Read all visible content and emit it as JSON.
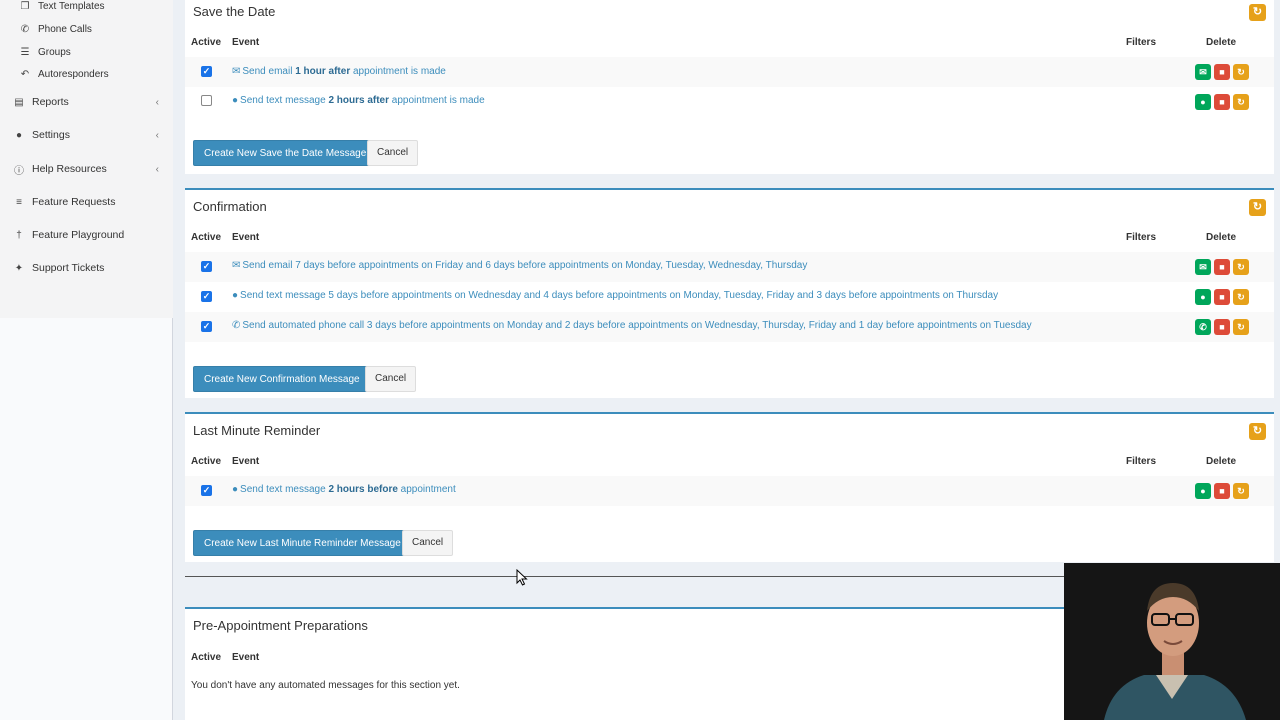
{
  "sidebar": {
    "sub_items": [
      {
        "label": "Text Templates",
        "icon": "copy-icon"
      },
      {
        "label": "Phone Calls",
        "icon": "phone-icon"
      },
      {
        "label": "Groups",
        "icon": "list-icon"
      },
      {
        "label": "Autoresponders",
        "icon": "reply-icon"
      }
    ],
    "items": [
      {
        "label": "Reports",
        "icon": "book-icon",
        "has_chevron": true
      },
      {
        "label": "Settings",
        "icon": "user-icon",
        "has_chevron": true
      },
      {
        "label": "Help Resources",
        "icon": "info-icon",
        "has_chevron": true
      },
      {
        "label": "Feature Requests",
        "icon": "list-ordered-icon",
        "has_chevron": false
      },
      {
        "label": "Feature Playground",
        "icon": "pin-icon",
        "has_chevron": false
      },
      {
        "label": "Support Tickets",
        "icon": "ticket-icon",
        "has_chevron": false
      }
    ]
  },
  "table_headers": {
    "active": "Active",
    "event": "Event",
    "filters": "Filters",
    "delete": "Delete"
  },
  "sections": {
    "save_the_date": {
      "title": "Save the Date",
      "rows": [
        {
          "active": true,
          "type": "email",
          "pre": "Send email ",
          "bold": "1 hour after",
          "post": " appointment is made"
        },
        {
          "active": false,
          "type": "text",
          "pre": "Send text message ",
          "bold": "2 hours after",
          "post": " appointment is made"
        }
      ],
      "create_label": "Create New Save the Date Message",
      "cancel_label": "Cancel"
    },
    "confirmation": {
      "title": "Confirmation",
      "rows": [
        {
          "active": true,
          "type": "email",
          "text": "Send email 7 days before appointments on Friday and 6 days before appointments on Monday, Tuesday, Wednesday, Thursday"
        },
        {
          "active": true,
          "type": "text",
          "text": "Send text message 5 days before appointments on Wednesday and 4 days before appointments on Monday, Tuesday, Friday and 3 days before appointments on Thursday"
        },
        {
          "active": true,
          "type": "phone",
          "text": "Send automated phone call 3 days before appointments on Monday and 2 days before appointments on Wednesday, Thursday, Friday and 1 day before appointments on Tuesday"
        }
      ],
      "create_label": "Create New Confirmation Message",
      "cancel_label": "Cancel"
    },
    "last_minute": {
      "title": "Last Minute Reminder",
      "rows": [
        {
          "active": true,
          "type": "text",
          "pre": "Send text message ",
          "bold": "2 hours before",
          "post": " appointment"
        }
      ],
      "create_label": "Create New Last Minute Reminder Message",
      "cancel_label": "Cancel"
    },
    "pre_appointment": {
      "title": "Pre-Appointment Preparations",
      "empty_message": "You don't have any automated messages for this section yet."
    }
  },
  "colors": {
    "primary": "#3c8dbc",
    "green": "#00a65a",
    "red": "#dd4b39",
    "orange": "#e6a11a"
  }
}
